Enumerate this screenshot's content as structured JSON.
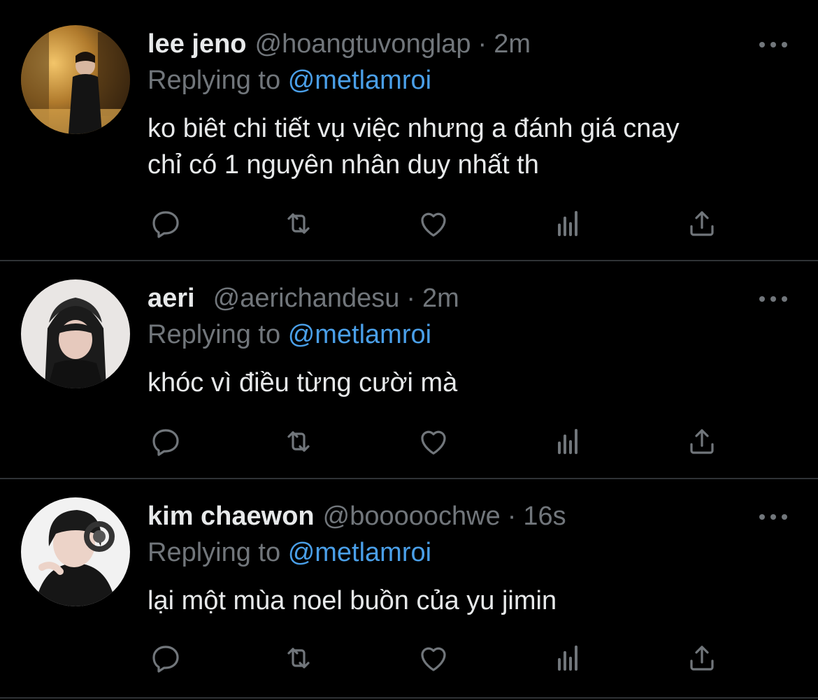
{
  "tweets": [
    {
      "name": "lee jeno",
      "handle": "@hoangtuvonglap",
      "separator": "·",
      "time": "2m",
      "replying_prefix": "Replying to",
      "replying_to": "@metlamroi",
      "text_lines": [
        "ko biêt chi tiết vụ việc nhưng a đánh giá cnay",
        "chỉ có 1 nguyên nhân duy nhất th"
      ]
    },
    {
      "name": "aeri",
      "handle": "@aerichandesu",
      "separator": "·",
      "time": "2m",
      "replying_prefix": "Replying to",
      "replying_to": "@metlamroi",
      "text_lines": [
        "khóc vì điều từng cười mà"
      ]
    },
    {
      "name": "kim chaewon",
      "handle": "@booooochwe",
      "separator": "·",
      "time": "16s",
      "replying_prefix": "Replying to",
      "replying_to": "@metlamroi",
      "text_lines": [
        "lại một mùa noel buồn của yu jimin"
      ]
    }
  ],
  "icons": {
    "reply": "reply-icon",
    "retweet": "retweet-icon",
    "like": "heart-icon",
    "views": "views-icon",
    "share": "share-icon",
    "more": "more-icon"
  },
  "colors": {
    "background": "#000000",
    "text": "#e7e9ea",
    "muted": "#71767b",
    "link": "#4a9fe8",
    "divider": "#2f3336"
  }
}
